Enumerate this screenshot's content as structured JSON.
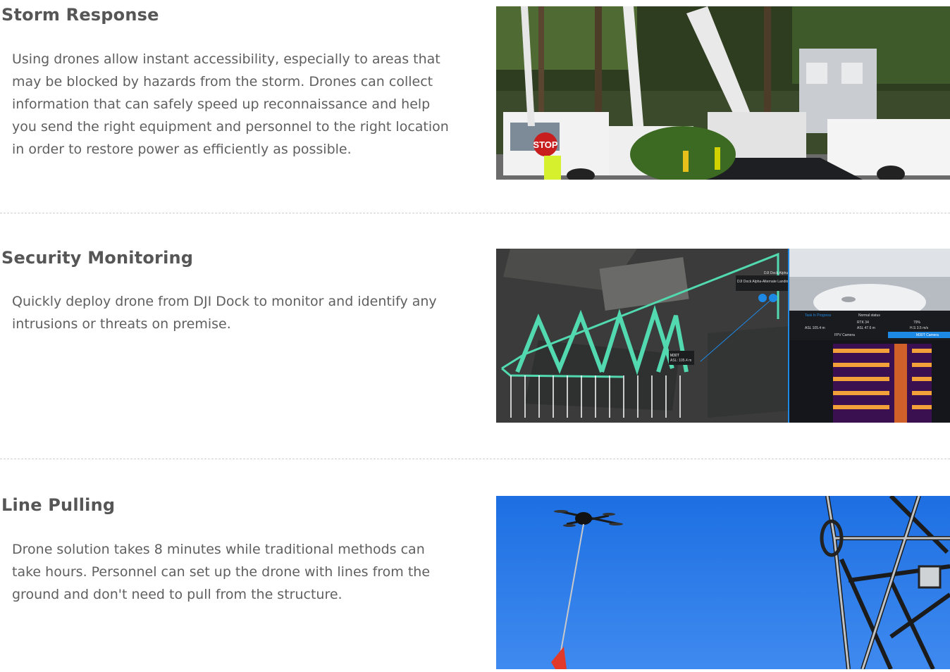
{
  "sections": [
    {
      "title": "Storm Response",
      "bullet": "•",
      "text": "Using drones allow instant accessibility, especially to areas that may be blocked by hazards from the storm.  Drones can collect information that can safely speed up reconnaissance and help you send the right equipment and personnel to the right location in order to restore power as efficiently as possible.",
      "image_sign": "STOP"
    },
    {
      "title": "Security Monitoring",
      "bullet": "•",
      "text": "Quickly deploy drone from DJI Dock to monitor and identify any intrusions or threats on premise.",
      "image_labels": {
        "dock": "DJI Dock Alpha-Alternate Landing",
        "dock_short": "DJI Dock Alphu",
        "drone": "M30T",
        "drone_asl": "ASL: 105.4 m",
        "task": "Task In Progress",
        "status": "Normal status",
        "rtk": "RTK 34",
        "battery": "79%",
        "asl1": "ASL 105.4 m",
        "asl2": "ASL 47.6 m",
        "hs": "H.S 3.5 m/s",
        "fpv": "FPV Camera",
        "cam": "M30T Camera"
      }
    },
    {
      "title": "Line Pulling",
      "bullet": "•",
      "text": "Drone solution takes 8 minutes while traditional methods can take hours.  Personnel can set up the drone with lines from the ground and don't need to pull from the structure."
    }
  ],
  "colors": {
    "heading": "#565656",
    "text": "#5f5f5f",
    "divider": "#cfcfcf",
    "sky": "#1e6fe0",
    "accent_blue": "#1e88e5",
    "path_green": "#52d9b0"
  }
}
